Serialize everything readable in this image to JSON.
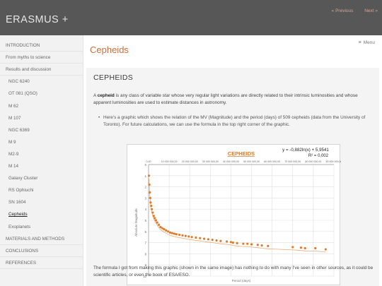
{
  "site": {
    "title": "ERASMUS +"
  },
  "pager": {
    "previous": "« Previous",
    "next": "Next »"
  },
  "page": {
    "title": "Cepheids",
    "menu_label": "Menu"
  },
  "sidebar": {
    "items": [
      {
        "label": "INTRODUCTION",
        "level": "top"
      },
      {
        "label": "From myths to science",
        "level": "top"
      },
      {
        "label": "Results and discussion",
        "level": "top"
      },
      {
        "label": "NGC 6240",
        "level": "sub"
      },
      {
        "label": "OT 081 (QSO)",
        "level": "sub"
      },
      {
        "label": "M 62",
        "level": "sub"
      },
      {
        "label": "M 107",
        "level": "sub"
      },
      {
        "label": "NGC 6369",
        "level": "sub"
      },
      {
        "label": "M 9",
        "level": "sub"
      },
      {
        "label": "M2-9",
        "level": "sub"
      },
      {
        "label": "M 14",
        "level": "sub"
      },
      {
        "label": "Galaxy Cluster",
        "level": "sub"
      },
      {
        "label": "RS Ophiuchi",
        "level": "sub"
      },
      {
        "label": "SN 1604",
        "level": "sub"
      },
      {
        "label": "Cepheids",
        "level": "sub",
        "active": true
      },
      {
        "label": "Exoplanets",
        "level": "sub"
      },
      {
        "label": "MATERIALS AND METHODS",
        "level": "top"
      },
      {
        "label": "CONCLUSIONS",
        "level": "top"
      },
      {
        "label": "REFERENCES",
        "level": "top"
      }
    ]
  },
  "content": {
    "heading": "CEPHEIDS",
    "intro_bold": "cepheid",
    "intro_prefix": "A ",
    "intro_rest": " is any class of variable star whose very regular light variations are directly related to their intrinsic luminosities and whose apparent luminosities are used to estimate distances in astronomy.",
    "bullet": "Here's a graphic which shows the relation of the MV (Magnitude) and the period (days) of 509 cepheids (data from the University of Toronto). For future calculations, we can use the formula in the top right corner of the graphic.",
    "closing": "The formula I got from making this graphic (shown in the same image) has nothing to do with many I've seen in other sources, as it could be scientific articles, or even the book of ESA/ESO."
  },
  "colors": {
    "accent": "#c9703a",
    "topbar": "#575757",
    "series": "#e07b2a"
  },
  "chart_data": {
    "type": "scatter",
    "title": "CEPHEIDS",
    "equation": "y = -0,882ln(x) + 5,9541",
    "r_squared": "R² = 0,002",
    "xlabel": "Period (days)",
    "ylabel": "Absolute Magnitude",
    "xlim": [
      0,
      90000000
    ],
    "ylim": [
      0,
      10
    ],
    "y_inverted": true,
    "x_ticks": [
      "0,00",
      "10 000 000,00",
      "20 000 000,00",
      "30 000 000,00",
      "40 000 000,00",
      "50 000 000,00",
      "60 000 000,00",
      "70 000 000,00",
      "80 000 000,00",
      "90 000 000,00"
    ],
    "y_ticks": [
      "0",
      "1",
      "2",
      "3",
      "4",
      "5",
      "6",
      "7",
      "8",
      "9",
      "10"
    ],
    "x_tick_values": [
      0,
      10000000,
      20000000,
      30000000,
      40000000,
      50000000,
      60000000,
      70000000,
      80000000,
      90000000
    ],
    "y_tick_values": [
      0,
      1,
      2,
      3,
      4,
      5,
      6,
      7,
      8,
      9,
      10
    ],
    "grid": true,
    "series": [
      {
        "x": [
          200000,
          400000,
          600000,
          800000,
          1000000,
          1300000,
          1600000,
          2000000,
          2500000,
          3000000,
          3600000,
          4200000,
          5000000,
          5800000,
          6600000,
          7500000,
          8500000,
          9500000,
          10500000,
          11500000,
          12500000,
          13500000,
          15000000,
          16500000,
          18000000,
          19500000,
          21000000,
          23000000,
          25000000,
          27000000,
          29000000,
          31000000,
          33000000,
          35000000,
          38000000,
          40000000,
          41000000,
          43000000,
          46000000,
          48000000,
          50000000,
          53000000,
          55000000,
          58000000,
          70000000,
          74000000,
          76000000,
          81000000,
          86000000
        ],
        "y": [
          1.0,
          1.8,
          2.5,
          3.0,
          3.4,
          3.7,
          4.0,
          4.3,
          4.6,
          4.8,
          5.0,
          5.2,
          5.4,
          5.6,
          5.7,
          5.8,
          5.9,
          6.0,
          6.1,
          6.15,
          6.2,
          6.25,
          6.3,
          6.35,
          6.4,
          6.45,
          6.5,
          6.55,
          6.6,
          6.65,
          6.7,
          6.75,
          6.8,
          6.85,
          6.9,
          6.95,
          7.0,
          7.05,
          7.1,
          7.1,
          7.15,
          7.2,
          7.25,
          7.3,
          7.4,
          7.45,
          7.5,
          7.5,
          7.6
        ]
      }
    ]
  }
}
